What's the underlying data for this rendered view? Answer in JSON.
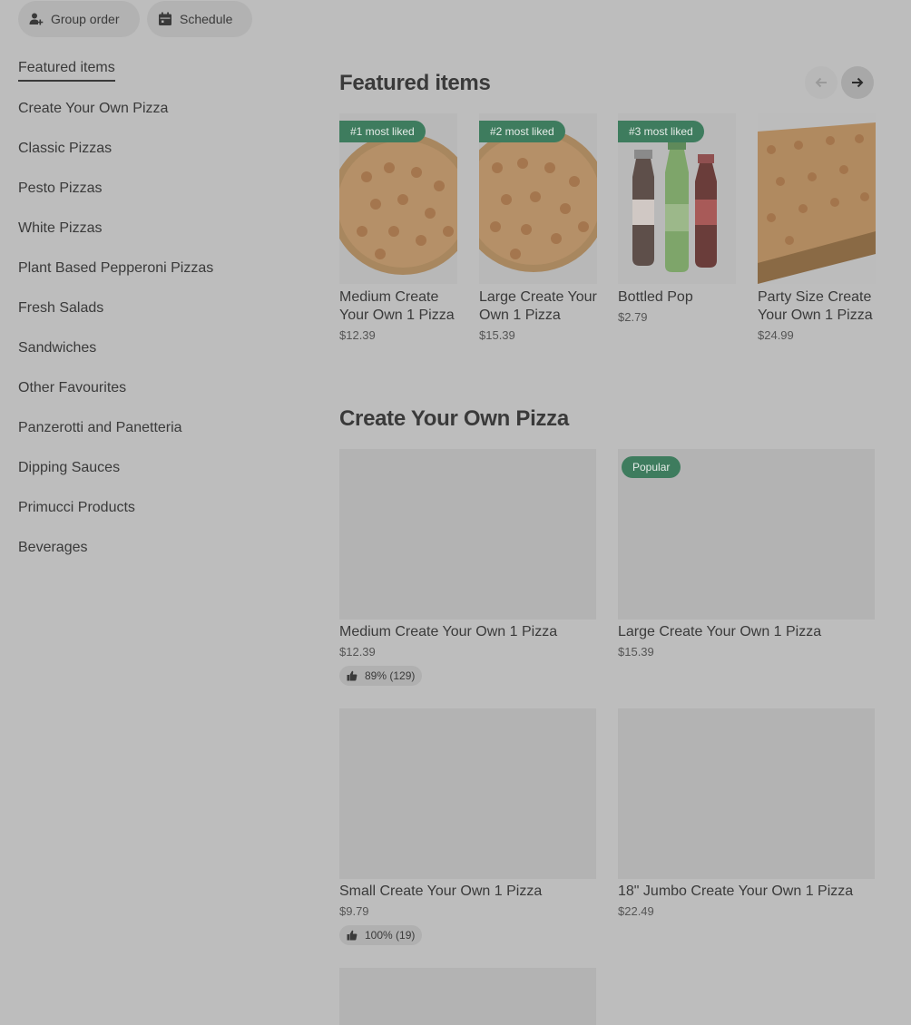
{
  "top_actions": {
    "group_order_label": "Group order",
    "schedule_label": "Schedule"
  },
  "sidebar": {
    "items": [
      {
        "label": "Featured items",
        "active": true
      },
      {
        "label": "Create Your Own Pizza"
      },
      {
        "label": "Classic Pizzas"
      },
      {
        "label": "Pesto Pizzas"
      },
      {
        "label": "White Pizzas"
      },
      {
        "label": "Plant Based Pepperoni Pizzas"
      },
      {
        "label": "Fresh Salads"
      },
      {
        "label": "Sandwiches"
      },
      {
        "label": "Other Favourites"
      },
      {
        "label": "Panzerotti and Panetteria"
      },
      {
        "label": "Dipping Sauces"
      },
      {
        "label": "Primucci Products"
      },
      {
        "label": "Beverages"
      }
    ]
  },
  "featured": {
    "title": "Featured items",
    "prev_icon": "arrow-left-icon",
    "next_icon": "arrow-right-icon",
    "items": [
      {
        "badge": "#1 most liked",
        "title": "Medium Create Your Own 1 Pizza",
        "price": "$12.39",
        "image": "round-pepperoni-pizza"
      },
      {
        "badge": "#2 most liked",
        "title": "Large Create Your Own 1 Pizza",
        "price": "$15.39",
        "image": "round-pepperoni-pizza"
      },
      {
        "badge": "#3 most liked",
        "title": "Bottled Pop",
        "price": "$2.79",
        "image": "soda-bottles"
      },
      {
        "title": "Party Size Create Your Own 1 Pizza",
        "price": "$24.99",
        "image": "rectangular-pizza"
      }
    ]
  },
  "create_your_own": {
    "title": "Create Your Own Pizza",
    "items": [
      {
        "title": "Medium Create Your Own 1 Pizza",
        "price": "$12.39",
        "rating": "89% (129)"
      },
      {
        "badge": "Popular",
        "title": "Large Create Your Own 1 Pizza",
        "price": "$15.39"
      },
      {
        "title": "Small Create Your Own 1 Pizza",
        "price": "$9.79",
        "rating": "100% (19)"
      },
      {
        "title": "18\" Jumbo Create Your Own 1 Pizza",
        "price": "$22.49"
      }
    ]
  },
  "colors": {
    "overlay_bg": "#bdbdbd",
    "badge_green": "#3e7c5e",
    "text_dark": "#3a3a3a"
  }
}
